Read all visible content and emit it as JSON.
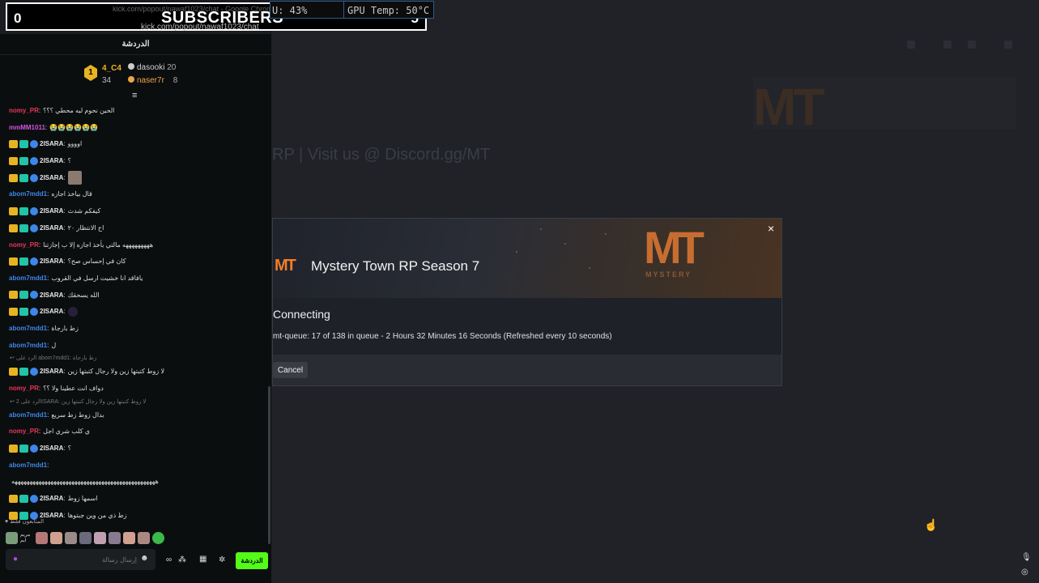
{
  "overlay": {
    "left_count": "0",
    "title": "SUBSCRIBERS",
    "right_count": "5",
    "url_top": "kick.com/popout/nawaf1023/chat - Google Chrome",
    "url": "kick.com/popout/nawaf1023/chat",
    "cpu": "U: 43%",
    "gpu": "GPU Temp: 50°C"
  },
  "background": {
    "server_title": "RP | Visit us @ Discord.gg/MT",
    "banner_text": "MT"
  },
  "chat": {
    "header": "الدردشة",
    "top_gifters": {
      "first_rank": "1",
      "first_name": "4_C4",
      "first_count": "34",
      "second_name": "dasooki",
      "second_count": "20",
      "third_name": "naser7r",
      "third_count": "8"
    },
    "scroll_icon": "≡",
    "messages": [
      {
        "kind": "msg",
        "user": "nomy_PR",
        "color": "#e8355a",
        "badges": [],
        "text": "الحين نحوم ليه محطي ؟؟؟"
      },
      {
        "kind": "msg",
        "user": "mmMM1011",
        "color": "#d552e0",
        "badges": [],
        "text": "😭😭😭😭😭😭"
      },
      {
        "kind": "msg",
        "user": "2ISARA",
        "color": "#e8e8e8",
        "badges": [
          "crown",
          "sub",
          "ver"
        ],
        "text": "اوووو"
      },
      {
        "kind": "msg",
        "user": "2ISARA",
        "color": "#e8e8e8",
        "badges": [
          "crown",
          "sub",
          "ver"
        ],
        "text": "؟"
      },
      {
        "kind": "msg",
        "user": "2ISARA",
        "color": "#e8e8e8",
        "badges": [
          "crown",
          "sub",
          "ver"
        ],
        "text": "",
        "emoji": "img"
      },
      {
        "kind": "msg",
        "user": "abom7mdd1",
        "color": "#3f86e8",
        "badges": [],
        "text": "قال بياخذ اجازه"
      },
      {
        "kind": "msg",
        "user": "2ISARA",
        "color": "#e8e8e8",
        "badges": [
          "crown",
          "sub",
          "ver"
        ],
        "text": "كيفكم شدث"
      },
      {
        "kind": "msg",
        "user": "2ISARA",
        "color": "#e8e8e8",
        "badges": [
          "crown",
          "sub",
          "ver"
        ],
        "text": "اح الانتظار ٢٠"
      },
      {
        "kind": "msg",
        "user": "nomy_PR",
        "color": "#e8355a",
        "badges": [],
        "text": "هههههههههه مالتي بأخذ اجازه إلا ب إجازتنا"
      },
      {
        "kind": "msg",
        "user": "2ISARA",
        "color": "#e8e8e8",
        "badges": [
          "crown",
          "sub",
          "ver"
        ],
        "text": "كان في إحساس صح؟"
      },
      {
        "kind": "msg",
        "user": "abom7mdd1",
        "color": "#3f86e8",
        "badges": [],
        "text": "يافاقد انا خشيت ارسل في القروب"
      },
      {
        "kind": "msg",
        "user": "2ISARA",
        "color": "#e8e8e8",
        "badges": [
          "crown",
          "sub",
          "ver"
        ],
        "text": "الله يسحقك"
      },
      {
        "kind": "msg",
        "user": "2ISARA",
        "color": "#e8e8e8",
        "badges": [
          "crown",
          "sub",
          "ver"
        ],
        "text": "",
        "emoji": "dark"
      },
      {
        "kind": "msg",
        "user": "abom7mdd1",
        "color": "#3f86e8",
        "badges": [],
        "text": "زط بارجاة"
      },
      {
        "kind": "msg",
        "user": "abom7mdd1",
        "color": "#3f86e8",
        "badges": [],
        "text": "ل"
      },
      {
        "kind": "reply",
        "text": "↩ الرد على abom7mdd1: زط بارجاة"
      },
      {
        "kind": "msg",
        "user": "2ISARA",
        "color": "#e8e8e8",
        "badges": [
          "crown",
          "sub",
          "ver"
        ],
        "text": "لا زوط كتبتها زين ولا رجال كتبتها زين"
      },
      {
        "kind": "msg",
        "user": "nomy_PR",
        "color": "#e8355a",
        "badges": [],
        "text": "دواف انت عطينا ولا ؟؟"
      },
      {
        "kind": "reply",
        "text": "↩ الرد على 2ISARA: لا زوط كتبتها زين ولا رجال كتبتها زين"
      },
      {
        "kind": "msg",
        "user": "abom7mdd1",
        "color": "#3f86e8",
        "badges": [],
        "text": "بدال زوط زط سريع"
      },
      {
        "kind": "msg",
        "user": "nomy_PR",
        "color": "#e8355a",
        "badges": [],
        "text": "ي كلب شري اجل"
      },
      {
        "kind": "msg",
        "user": "2ISARA",
        "color": "#e8e8e8",
        "badges": [
          "crown",
          "sub",
          "ver"
        ],
        "text": "؟"
      },
      {
        "kind": "msg",
        "user": "abom7mdd1",
        "color": "#3f86e8",
        "badges": [],
        "text": ""
      },
      {
        "kind": "msg",
        "user": "",
        "color": "#e8e8e8",
        "badges": [],
        "text": "ههههههههههههههههههههههههههههههههههههههههههههههههه"
      },
      {
        "kind": "msg",
        "user": "2ISARA",
        "color": "#e8e8e8",
        "badges": [
          "crown",
          "sub",
          "ver"
        ],
        "text": "اسمها زوط"
      },
      {
        "kind": "msg",
        "user": "2ISARA",
        "color": "#e8e8e8",
        "badges": [
          "crown",
          "sub",
          "ver"
        ],
        "text": "زط ذي من وين جبتوها"
      }
    ],
    "followers_label": "♥ المتابعون فقط",
    "avatar_name": "مريم ايم",
    "avatar_colors": [
      "#7a9c7a",
      "#b47878",
      "#cfa090",
      "#9a8a8a",
      "#6a6a7a",
      "#c0a0b0",
      "#8a7a90",
      "#d0a090",
      "#aa8880",
      "#3cb94a"
    ],
    "composer_placeholder": "إرسال رسالة",
    "send_label": "الدردشة"
  },
  "modal": {
    "title": "Mystery Town RP Season 7",
    "logo_small": "MT",
    "logo_big": "MT",
    "logo_sub": "MYSTERY",
    "close_label": "×",
    "status": "Connecting",
    "queue_text": "mt-queue: 17 of 138 in queue - 2 Hours 32 Minutes 16 Seconds (Refreshed every 10 seconds)",
    "cancel_label": "Cancel"
  },
  "colors": {
    "kick_green": "#53fc18",
    "accent_orange": "#f07d2a"
  }
}
